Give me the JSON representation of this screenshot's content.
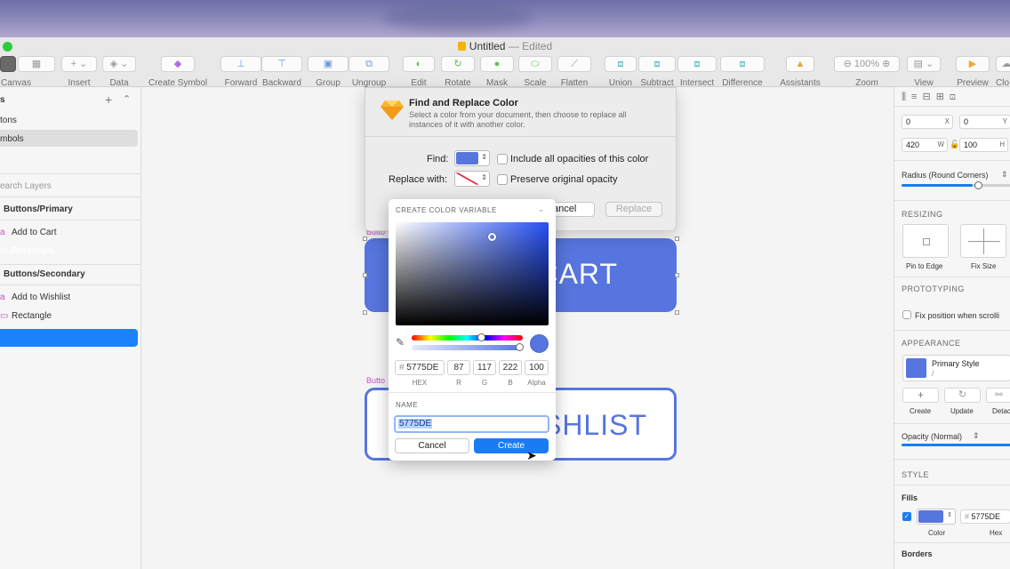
{
  "window": {
    "title": "Untitled",
    "title_suffix": "— Edited"
  },
  "toolbar": {
    "items": [
      {
        "label": "Canvas"
      },
      {
        "label": "Insert"
      },
      {
        "label": "Data"
      },
      {
        "label": "Create Symbol"
      },
      {
        "label": "Forward"
      },
      {
        "label": "Backward"
      },
      {
        "label": "Group"
      },
      {
        "label": "Ungroup"
      },
      {
        "label": "Edit"
      },
      {
        "label": "Rotate"
      },
      {
        "label": "Mask"
      },
      {
        "label": "Scale"
      },
      {
        "label": "Flatten"
      },
      {
        "label": "Union"
      },
      {
        "label": "Subtract"
      },
      {
        "label": "Intersect"
      },
      {
        "label": "Difference"
      },
      {
        "label": "Assistants"
      },
      {
        "label": "Zoom"
      },
      {
        "label": "View"
      },
      {
        "label": "Preview"
      },
      {
        "label": "Clo"
      }
    ],
    "zoom_value": "100%"
  },
  "sidebar": {
    "pages": [
      {
        "label": "tons"
      },
      {
        "label": "mbols"
      }
    ],
    "search_placeholder": "earch Layers",
    "groups": [
      {
        "label": "Buttons/Primary",
        "layers": [
          {
            "label": "Add to Cart"
          },
          {
            "label": "Rectangle"
          }
        ]
      },
      {
        "label": "Buttons/Secondary",
        "layers": [
          {
            "label": "Add to Wishlist"
          },
          {
            "label": "Rectangle"
          }
        ]
      }
    ]
  },
  "canvas": {
    "primary_text": "CART",
    "secondary_text": "SHLIST",
    "primary_artboard_label": "Butto",
    "secondary_artboard_label": "Butto",
    "accent_color": "#5775de"
  },
  "dialog": {
    "title": "Find and Replace Color",
    "description_line1": "Select a color from your document, then choose to replace all",
    "description_line2": "instances of it with another color.",
    "find_label": "Find:",
    "replace_label": "Replace with:",
    "include_opacities_label": "Include all opacities of this color",
    "preserve_opacity_label": "Preserve original opacity",
    "cancel_label": "ancel",
    "replace_button_label": "Replace"
  },
  "color_picker": {
    "header": "CREATE COLOR VARIABLE",
    "hex": "5775DE",
    "r": "87",
    "g": "117",
    "b": "222",
    "alpha": "100",
    "hex_caption": "HEX",
    "r_caption": "R",
    "g_caption": "G",
    "b_caption": "B",
    "alpha_caption": "Alpha",
    "name_label": "NAME",
    "name_value": "5775DE",
    "cancel_label": "Cancel",
    "create_label": "Create",
    "hex_prefix": "#"
  },
  "inspector": {
    "x": "0",
    "y": "0",
    "w": "420",
    "h": "100",
    "x_label": "X",
    "y_label": "Y",
    "w_label": "W",
    "h_label": "H",
    "radius_label": "Radius (Round Corners)",
    "resizing_header": "RESIZING",
    "pin_to_edge": "Pin to Edge",
    "fix_size": "Fix Size",
    "prototyping_header": "PROTOTYPING",
    "fix_position_label": "Fix position when scrolli",
    "appearance_header": "APPEARANCE",
    "style_name": "Primary Style",
    "style_sub": "/",
    "create_label": "Create",
    "update_label": "Update",
    "detach_label": "Detac",
    "opacity_label": "Opacity (Normal)",
    "style_header": "STYLE",
    "fills_label": "Fills",
    "fill_hex": "5775DE",
    "fill_hex_prefix": "#",
    "color_caption": "Color",
    "hex_caption": "Hex",
    "borders_label": "Borders"
  }
}
